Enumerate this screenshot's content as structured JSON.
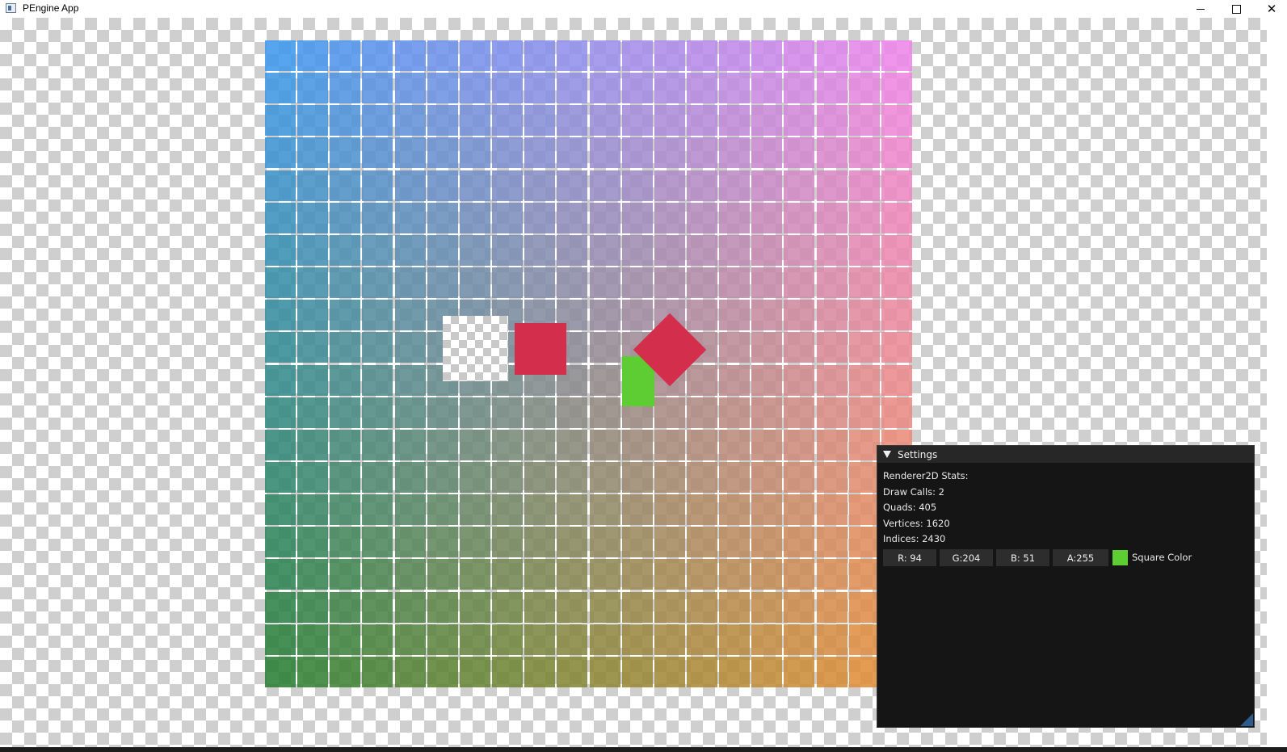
{
  "window": {
    "title": "PEngine App",
    "minimize_icon": "minimize-icon",
    "maximize_icon": "maximize-icon",
    "close_icon": "close-icon"
  },
  "scene": {
    "grid": {
      "columns": 20,
      "rows": 20,
      "top_left_color": "#4097ed",
      "top_right_color": "#ee86e9",
      "bottom_left_color": "#2b8035",
      "bottom_right_color": "#e98f3a",
      "tile_alpha": 0.88
    },
    "quads": {
      "textured": "checkerboard-texture",
      "red_square_color": "#d32f4c",
      "green_quad_color": "#5ecc33",
      "rotated_square_color": "#d32f4c"
    }
  },
  "settings": {
    "title": "Settings",
    "stats_heading": "Renderer2D Stats:",
    "draw_calls": "Draw Calls: 2",
    "quads": "Quads: 405",
    "vertices": "Vertices: 1620",
    "indices": "Indices: 2430",
    "color_r": "R: 94",
    "color_g": "G:204",
    "color_b": "B: 51",
    "color_a": "A:255",
    "swatch_color": "#5ecc33",
    "color_label": "Square Color"
  }
}
